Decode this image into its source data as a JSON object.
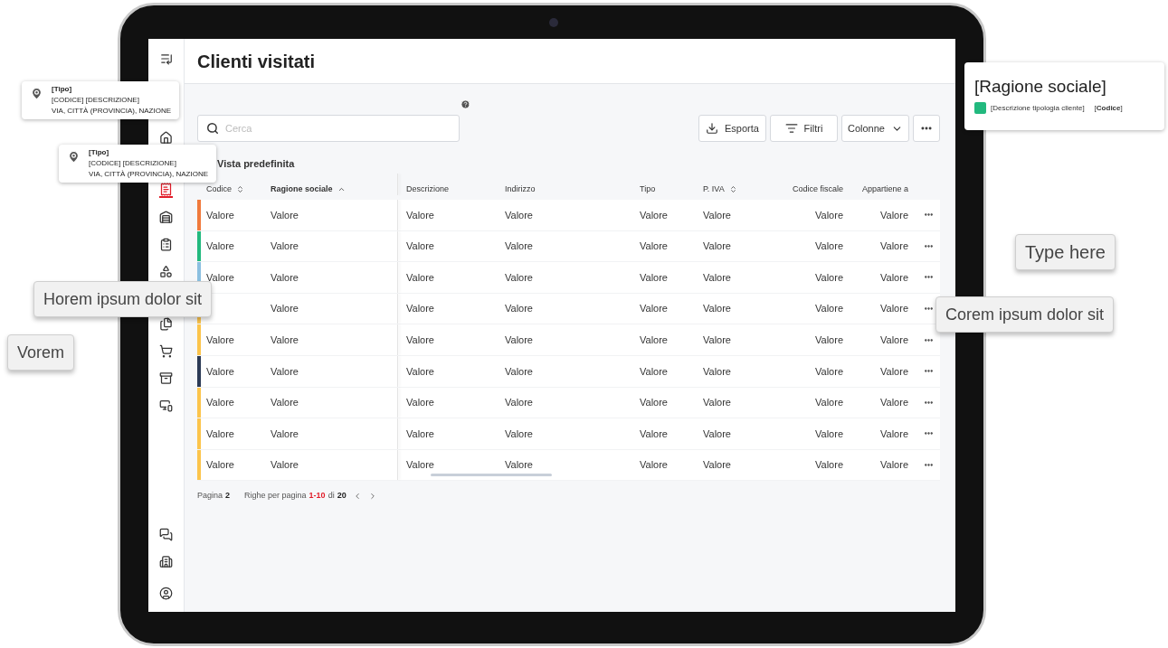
{
  "screen": {
    "title": "Clienti visitati",
    "sidebar": {
      "items": [
        {
          "kind": "home",
          "selected": false
        },
        {
          "kind": "receipt",
          "selected": true
        },
        {
          "kind": "warehouse",
          "selected": false
        },
        {
          "kind": "list",
          "selected": false
        },
        {
          "kind": "shapes",
          "selected": false
        },
        {
          "kind": "files",
          "selected": false
        },
        {
          "kind": "cart",
          "selected": false
        },
        {
          "kind": "archive",
          "selected": false
        },
        {
          "kind": "devices",
          "selected": false
        }
      ],
      "bottom_items": [
        {
          "kind": "chat",
          "selected": false
        },
        {
          "kind": "building",
          "selected": false
        },
        {
          "kind": "account",
          "selected": false
        }
      ]
    },
    "search": {
      "placeholder": "Cerca"
    },
    "toolbar": [
      {
        "kind": "download",
        "label": "Esporta"
      },
      {
        "kind": "filter",
        "label": "Filtri"
      },
      {
        "kind": "dropdown",
        "label": "Colonne"
      },
      {
        "kind": "more"
      }
    ],
    "view": "Vista predefinita",
    "table": {
      "columns": [
        {
          "label": "Codice",
          "sortable": true,
          "sorted": false
        },
        {
          "label": "Ragione sociale",
          "sortable": true,
          "sorted": true
        },
        {
          "label": "Descrizione"
        },
        {
          "label": "Indirizzo"
        },
        {
          "label": "Tipo"
        },
        {
          "label": "P. IVA",
          "sortable": true,
          "sorted": false
        },
        {
          "label": "Codice fiscale"
        },
        {
          "label": "Appartiene a"
        }
      ],
      "rows": [
        {
          "color": "#f07a3c",
          "cells": [
            "Valore",
            "Valore",
            "Valore",
            "Valore",
            "Valore",
            "Valore",
            "Valore",
            "Valore"
          ]
        },
        {
          "color": "#22b97e",
          "cells": [
            "Valore",
            "Valore",
            "Valore",
            "Valore",
            "Valore",
            "Valore",
            "Valore",
            "Valore"
          ]
        },
        {
          "color": "#8bbfe0",
          "cells": [
            "Valore",
            "Valore",
            "Valore",
            "Valore",
            "Valore",
            "Valore",
            "Valore",
            "Valore"
          ]
        },
        {
          "color": "#fcc44b",
          "cells": [
            null,
            "Valore",
            "Valore",
            "Valore",
            "Valore",
            "Valore",
            "Valore",
            "Valore"
          ]
        },
        {
          "color": "#fcc44b",
          "cells": [
            "Valore",
            "Valore",
            "Valore",
            "Valore",
            "Valore",
            "Valore",
            "Valore",
            "Valore"
          ]
        },
        {
          "color": "#2b3a55",
          "cells": [
            "Valore",
            "Valore",
            "Valore",
            "Valore",
            "Valore",
            "Valore",
            "Valore",
            "Valore"
          ]
        },
        {
          "color": "#fcc44b",
          "cells": [
            "Valore",
            "Valore",
            "Valore",
            "Valore",
            "Valore",
            "Valore",
            "Valore",
            "Valore"
          ]
        },
        {
          "color": "#fcc44b",
          "cells": [
            "Valore",
            "Valore",
            "Valore",
            "Valore",
            "Valore",
            "Valore",
            "Valore",
            "Valore"
          ]
        },
        {
          "color": "#fcc44b",
          "cells": [
            "Valore",
            "Valore",
            "Valore",
            "Valore",
            "Valore",
            "Valore",
            "Valore",
            "Valore"
          ]
        }
      ]
    },
    "pagination": {
      "page_label": "Pagina",
      "page": "2",
      "rows_label": "Righe per pagina",
      "range": "1-10",
      "of": "di",
      "total": "20"
    }
  },
  "pin_cards": [
    {
      "type": "[Tipo]",
      "code": "[CODICE] [DESCRIZIONE]",
      "address": "VIA, CITTÀ (PROVINCIA), NAZIONE"
    },
    {
      "type": "[Tipo]",
      "code": "[CODICE] [DESCRIZIONE]",
      "address": "VIA, CITTÀ (PROVINCIA), NAZIONE"
    }
  ],
  "client_card": {
    "name": "[Ragione sociale]",
    "color": "#22b97e",
    "description": "[Descrizione tipologia cliente]",
    "code": "[**Codice**]"
  },
  "tooltips": [
    "Type here",
    "Corem ipsum dolor sit",
    "Horem ipsum dolor sit",
    "Vorem"
  ]
}
